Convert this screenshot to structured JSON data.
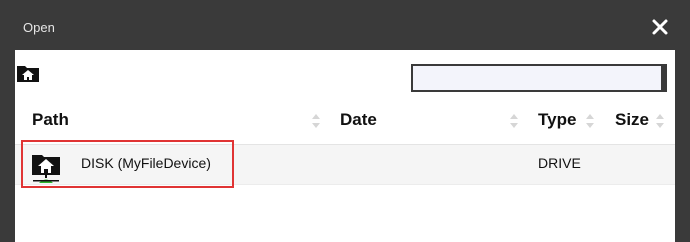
{
  "window": {
    "title": "Open",
    "close_icon": "close-icon"
  },
  "toolbar": {
    "home_icon": "home-folder-icon",
    "search": {
      "value": "",
      "placeholder": ""
    }
  },
  "table": {
    "columns": [
      {
        "label": "Path",
        "sortable": true
      },
      {
        "label": "Date",
        "sortable": true
      },
      {
        "label": "Type",
        "sortable": true
      },
      {
        "label": "Size",
        "sortable": true
      }
    ],
    "rows": [
      {
        "icon": "home-drive-icon",
        "path": "DISK (MyFileDevice)",
        "date": "",
        "type": "DRIVE",
        "size": ""
      }
    ]
  },
  "colors": {
    "frame": "#3a3a3a",
    "content_bg": "#ffffff",
    "row_bg": "#f5f5f5",
    "highlight": "#e03434",
    "drive_base": "#2fb52f"
  }
}
